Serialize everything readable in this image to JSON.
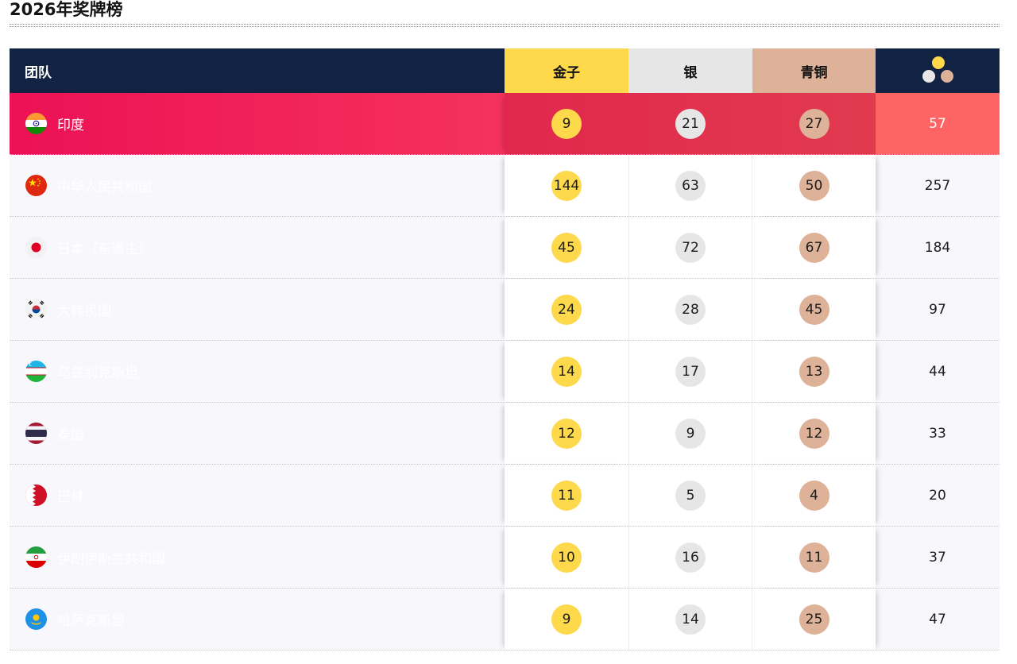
{
  "title": "2026年奖牌榜",
  "header": {
    "team": "团队",
    "gold": "金子",
    "silver": "银",
    "bronze": "青铜",
    "total_icon": "medal-dots-icon"
  },
  "colors": {
    "navy": "#122243",
    "gold": "#fdd94b",
    "silver": "#e6e6e6",
    "bronze": "#ddb298",
    "highlight": "#ec1155"
  },
  "rows": [
    {
      "team": "印度",
      "flag": "india-flag-icon",
      "gold": "9",
      "silver": "21",
      "bronze": "27",
      "total": "57",
      "highlight": true
    },
    {
      "team": "中华人民共和国",
      "flag": "china-flag-icon",
      "gold": "144",
      "silver": "63",
      "bronze": "50",
      "total": "257"
    },
    {
      "team": "日本（东道主）",
      "flag": "japan-flag-icon",
      "gold": "45",
      "silver": "72",
      "bronze": "67",
      "total": "184"
    },
    {
      "team": "大韩民国",
      "flag": "korea-flag-icon",
      "gold": "24",
      "silver": "28",
      "bronze": "45",
      "total": "97"
    },
    {
      "team": "乌兹别克斯坦",
      "flag": "uzbekistan-flag-icon",
      "gold": "14",
      "silver": "17",
      "bronze": "13",
      "total": "44"
    },
    {
      "team": "泰国",
      "flag": "thailand-flag-icon",
      "gold": "12",
      "silver": "9",
      "bronze": "12",
      "total": "33"
    },
    {
      "team": "巴林",
      "flag": "bahrain-flag-icon",
      "gold": "11",
      "silver": "5",
      "bronze": "4",
      "total": "20"
    },
    {
      "team": "伊朗伊斯兰共和国",
      "flag": "iran-flag-icon",
      "gold": "10",
      "silver": "16",
      "bronze": "11",
      "total": "37"
    },
    {
      "team": "哈萨克斯坦",
      "flag": "kazakhstan-flag-icon",
      "gold": "9",
      "silver": "14",
      "bronze": "25",
      "total": "47"
    }
  ]
}
